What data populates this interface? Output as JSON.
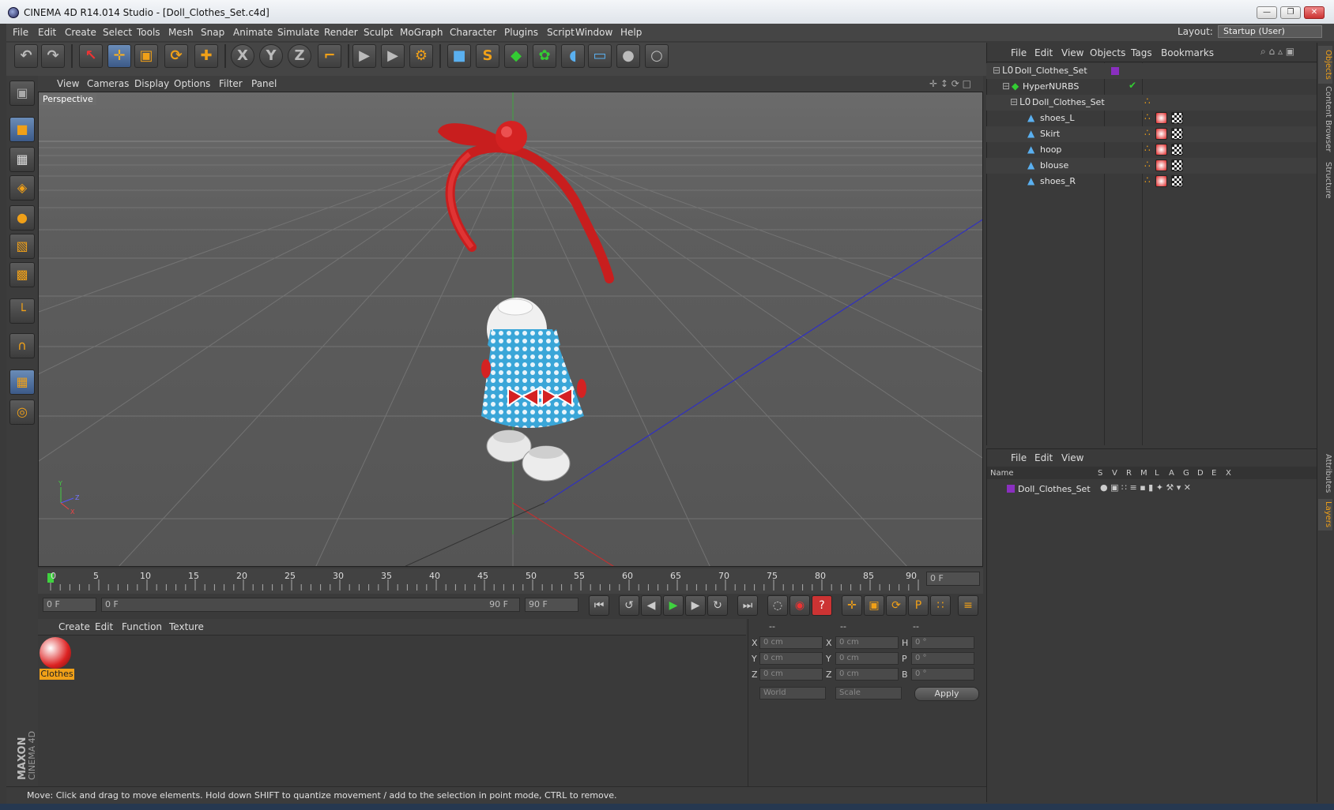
{
  "window": {
    "title": "CINEMA 4D R14.014 Studio - [Doll_Clothes_Set.c4d]",
    "minimize": "—",
    "restore": "❐",
    "close": "✕"
  },
  "menu": [
    "File",
    "Edit",
    "Create",
    "Select",
    "Tools",
    "Mesh",
    "Snap",
    "Animate",
    "Simulate",
    "Render",
    "Sculpt",
    "MoGraph",
    "Character",
    "Plugins",
    "Script",
    "Window",
    "Help"
  ],
  "layout": {
    "label": "Layout:",
    "value": "Startup (User)"
  },
  "toolbar": {
    "undo": "↶",
    "redo": "↷",
    "live_select": "↖",
    "move": "✛",
    "scale": "▣",
    "rotate": "⟳",
    "add": "✚",
    "x_axis": "X",
    "y_axis": "Y",
    "z_axis": "Z",
    "coord_system": "⌐",
    "render_view": "▶",
    "render_picture": "▶",
    "render_settings": "⚙",
    "cube": "■",
    "spline": "S",
    "nurbs": "◆",
    "array": "✿",
    "deformer": "◖",
    "floor": "▭",
    "camera": "●",
    "light": "○"
  },
  "viewport": {
    "menu": [
      "View",
      "Cameras",
      "Display",
      "Options",
      "Filter",
      "Panel"
    ],
    "label": "Perspective",
    "axis_y": "Y",
    "axis_z": "Z",
    "axis_x": "X"
  },
  "timeline": {
    "ticks": [
      "0",
      "5",
      "10",
      "15",
      "20",
      "25",
      "30",
      "35",
      "40",
      "45",
      "50",
      "55",
      "60",
      "65",
      "70",
      "75",
      "80",
      "85",
      "90"
    ],
    "current_frame": "0 F",
    "start_frame": "0 F",
    "range_start": "0 F",
    "range_end": "90 F",
    "end_frame": "90 F"
  },
  "transport": {
    "goto_start": "⏮",
    "prev_key": "↺",
    "prev_frame": "◀",
    "play": "▶",
    "next_frame": "▶",
    "next_key": "↻",
    "goto_end": "⏭",
    "record_off": "◌",
    "record": "◉",
    "help": "?",
    "move_key": "✛",
    "scale_key": "▣",
    "rot_key": "⟳",
    "param_key": "P",
    "pla_key": "∷",
    "timeline_btn": "≡"
  },
  "materials": {
    "menu": [
      "Create",
      "Edit",
      "Function",
      "Texture"
    ],
    "items": [
      {
        "name": "Clothes"
      }
    ]
  },
  "coordinates": {
    "header": [
      "--",
      "--",
      "--"
    ],
    "rows": [
      {
        "a_label": "X",
        "a_val": "0 cm",
        "b_label": "X",
        "b_val": "0 cm",
        "c_label": "H",
        "c_val": "0 °"
      },
      {
        "a_label": "Y",
        "a_val": "0 cm",
        "b_label": "Y",
        "b_val": "0 cm",
        "c_label": "P",
        "c_val": "0 °"
      },
      {
        "a_label": "Z",
        "a_val": "0 cm",
        "b_label": "Z",
        "b_val": "0 cm",
        "c_label": "B",
        "c_val": "0 °"
      }
    ],
    "mode_world": "World",
    "mode_scale": "Scale",
    "apply": "Apply"
  },
  "objects_panel": {
    "menu": [
      "File",
      "Edit",
      "View",
      "Objects",
      "Tags",
      "Bookmarks"
    ],
    "tree": [
      {
        "name": "Doll_Clothes_Set",
        "indent": 0,
        "type": "null"
      },
      {
        "name": "HyperNURBS",
        "indent": 1,
        "type": "hypernurbs"
      },
      {
        "name": "Doll_Clothes_Set",
        "indent": 2,
        "type": "null"
      },
      {
        "name": "shoes_L",
        "indent": 3,
        "type": "poly"
      },
      {
        "name": "Skirt",
        "indent": 3,
        "type": "poly"
      },
      {
        "name": "hoop",
        "indent": 3,
        "type": "poly"
      },
      {
        "name": "blouse",
        "indent": 3,
        "type": "poly"
      },
      {
        "name": "shoes_R",
        "indent": 3,
        "type": "poly"
      }
    ],
    "layer_color": "#8a2fc0",
    "check": "✔"
  },
  "layers_panel": {
    "menu": [
      "File",
      "Edit",
      "View"
    ],
    "columns": [
      "Name",
      "S",
      "V",
      "R",
      "M",
      "L",
      "A",
      "G",
      "D",
      "E",
      "X"
    ],
    "rows": [
      {
        "name": "Doll_Clothes_Set",
        "color": "#8a2fc0"
      }
    ]
  },
  "side_tabs": [
    "Objects",
    "Content Browser",
    "Structure",
    "Attributes",
    "Layers"
  ],
  "status": "Move: Click and drag to move elements. Hold down SHIFT to quantize movement / add to the selection in point mode, CTRL to remove.",
  "logo": {
    "line1": "MAXON",
    "line2": "CINEMA 4D"
  }
}
